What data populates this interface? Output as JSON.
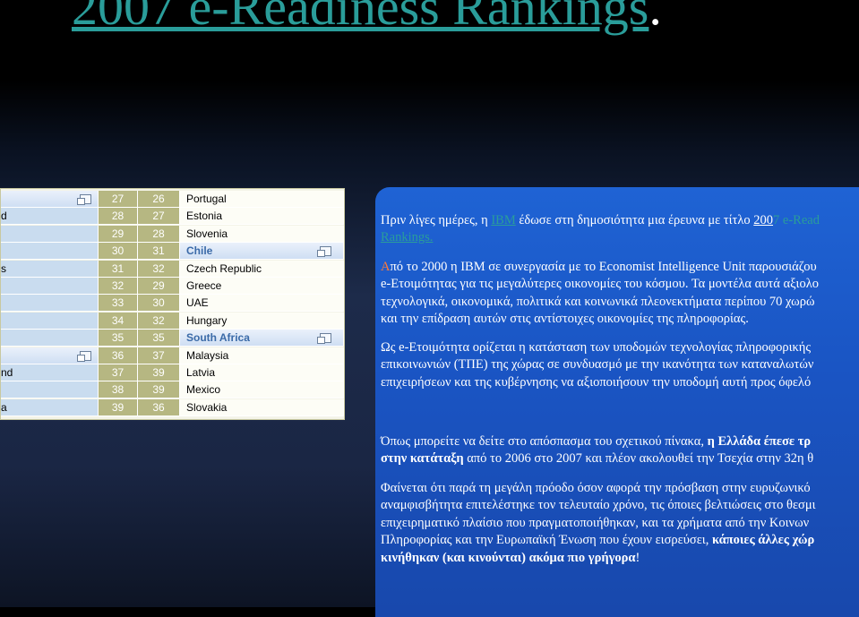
{
  "title": {
    "text": "2007 e-Readiness Rankings",
    "dot": "."
  },
  "rankings": [
    {
      "left": "",
      "rank2007": "27",
      "rank2006": "26",
      "country": "Portugal",
      "highlight": false,
      "left_highlight": true
    },
    {
      "left": "d",
      "rank2007": "28",
      "rank2006": "27",
      "country": "Estonia",
      "highlight": false,
      "left_highlight": false
    },
    {
      "left": "",
      "rank2007": "29",
      "rank2006": "28",
      "country": "Slovenia",
      "highlight": false,
      "left_highlight": false
    },
    {
      "left": "",
      "rank2007": "30",
      "rank2006": "31",
      "country": "Chile",
      "highlight": true,
      "left_highlight": false
    },
    {
      "left": "s",
      "rank2007": "31",
      "rank2006": "32",
      "country": "Czech Republic",
      "highlight": false,
      "left_highlight": false
    },
    {
      "left": "",
      "rank2007": "32",
      "rank2006": "29",
      "country": "Greece",
      "highlight": false,
      "left_highlight": false
    },
    {
      "left": "",
      "rank2007": "33",
      "rank2006": "30",
      "country": "UAE",
      "highlight": false,
      "left_highlight": false
    },
    {
      "left": "",
      "rank2007": "34",
      "rank2006": "32",
      "country": "Hungary",
      "highlight": false,
      "left_highlight": false
    },
    {
      "left": "",
      "rank2007": "35",
      "rank2006": "35",
      "country": "South Africa",
      "highlight": true,
      "left_highlight": false
    },
    {
      "left": "",
      "rank2007": "36",
      "rank2006": "37",
      "country": "Malaysia",
      "highlight": false,
      "left_highlight": true
    },
    {
      "left": "nd",
      "rank2007": "37",
      "rank2006": "39",
      "country": "Latvia",
      "highlight": false,
      "left_highlight": false
    },
    {
      "left": "",
      "rank2007": "38",
      "rank2006": "39",
      "country": "Mexico",
      "highlight": false,
      "left_highlight": false
    },
    {
      "left": "a",
      "rank2007": "39",
      "rank2006": "36",
      "country": "Slovakia",
      "highlight": false,
      "left_highlight": false
    }
  ],
  "panel": {
    "p1": {
      "a": "Πριν λίγες ημέρες, η ",
      "ibm": "IBM",
      "b": " έδωσε στη δημοσιότητα μια έρευνα με τίτλο ",
      "c1": "200",
      "c2": "7 e-Read",
      "line2": "Rankings."
    },
    "p2": {
      "first_letter": "Α",
      "line1": "πό το 2000 η IBM σε συνεργασία με το Economist Intelligence Unit παρουσιάζου",
      "line2": "e-Ετοιμότητας για τις μεγαλύτερες οικονομίες του κόσμου. Τα μοντέλα αυτά αξιολο",
      "line3": "τεχνολογικά, οικονομικά, πολιτικά και κοινωνικά πλεονεκτήματα περίπου 70 χωρώ",
      "line4": "και την επίδραση αυτών στις αντίστοιχες οικονομίες της πληροφορίας."
    },
    "p3": {
      "line1": "Ως e-Ετοιμότητα ορίζεται η κατάσταση των υποδομών τεχνολογίας πληροφορικής",
      "line2": "επικοινωνιών (ΤΠΕ) της χώρας σε συνδυασμό με την ικανότητα των καταναλωτών",
      "line3": "επιχειρήσεων και της κυβέρνησης να αξιοποιήσουν την υποδομή αυτή προς όφελό"
    },
    "p4": {
      "a": "Όπως μπορείτε να δείτε στο απόσπασμα του σχετικού πίνακα, ",
      "b_bold": "η Ελλάδα έπεσε τρ",
      "c_bold": "στην κατάταξη",
      "d": " από το 2006 στο 2007 και πλέον ακολουθεί την Τσεχία στην 32η θ"
    },
    "p5": {
      "line1": "Φαίνεται ότι παρά τη μεγάλη πρόοδο όσον αφορά την πρόσβαση στην ευρυζωνικό",
      "line2": "αναμφισβήτητα επιτελέστηκε τον τελευταίο χρόνο, τις όποιες βελτιώσεις στο θεσμι",
      "line3": "επιχειρηματικό πλαίσιο που πραγματοποιήθηκαν, και τα χρήματα από την Κοινων",
      "line4a": "Πληροφορίας και την Ευρωπαϊκή Ένωση που έχουν εισρεύσει, ",
      "line4b_bold": "κάποιες άλλες χώρ",
      "line5_bold": "κινήθηκαν (και κινούνται) ακόμα πιο γρήγορα",
      "line5_end": "!"
    }
  }
}
